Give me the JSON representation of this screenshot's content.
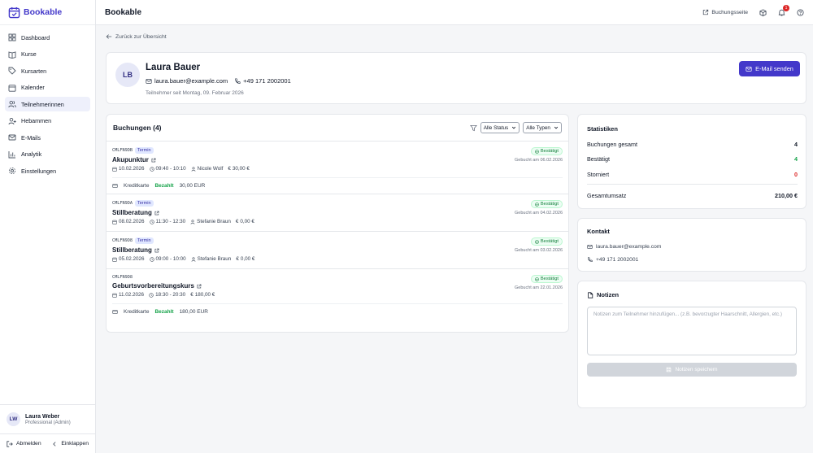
{
  "app": {
    "name": "Bookable"
  },
  "sidebar": {
    "items": [
      {
        "label": "Dashboard",
        "icon": "grid-icon"
      },
      {
        "label": "Kurse",
        "icon": "book-icon"
      },
      {
        "label": "Kursarten",
        "icon": "tag-icon"
      },
      {
        "label": "Kalender",
        "icon": "calendar-icon"
      },
      {
        "label": "Teilnehmerinnen",
        "icon": "users-icon",
        "active": true
      },
      {
        "label": "Hebammen",
        "icon": "user-plus-icon"
      },
      {
        "label": "E-Mails",
        "icon": "mail-icon"
      },
      {
        "label": "Analytik",
        "icon": "bar-chart-icon"
      },
      {
        "label": "Einstellungen",
        "icon": "gear-icon"
      }
    ],
    "user": {
      "initials": "LW",
      "name": "Laura Weber",
      "role": "Professional (Admin)"
    },
    "logout_label": "Abmelden",
    "collapse_label": "Einklappen"
  },
  "header": {
    "title": "Bookable",
    "booking_page_label": "Buchungsseite",
    "notification_count": "1"
  },
  "back_label": "Zurück zur Übersicht",
  "profile": {
    "initials": "LB",
    "name": "Laura Bauer",
    "email": "laura.bauer@example.com",
    "phone": "+49 171 2002001",
    "since": "Teilnehmer seit Montag, 09. Februar 2026",
    "email_button": "E-Mail senden"
  },
  "bookings": {
    "title": "Buchungen (4)",
    "filter_status": "Alle Status",
    "filter_type": "Alle Typen",
    "items": [
      {
        "code": "CMLFN9DB",
        "tag": "Termin",
        "title": "Akupunktur",
        "date": "10.02.2026",
        "time": "09:40 - 10:10",
        "person": "Nicole Wolf",
        "price": "30,00 €",
        "status": "Bestätigt",
        "booked": "Gebucht am 06.02.2026",
        "payment_method": "Kreditkarte",
        "payment_status": "Bezahlt",
        "payment_amount": "30,00 EUR"
      },
      {
        "code": "CMLFN9DA",
        "tag": "Termin",
        "title": "Stillberatung",
        "date": "08.02.2026",
        "time": "11:30 - 12:30",
        "person": "Stefanie Braun",
        "price": "0,00 €",
        "status": "Bestätigt",
        "booked": "Gebucht am 04.02.2026"
      },
      {
        "code": "CMLFN9D8",
        "tag": "Termin",
        "title": "Stillberatung",
        "date": "05.02.2026",
        "time": "09:00 - 10:00",
        "person": "Stefanie Braun",
        "price": "0,00 €",
        "status": "Bestätigt",
        "booked": "Gebucht am 03.02.2026"
      },
      {
        "code": "CMLFN9D8",
        "tag": "",
        "title": "Geburtsvorbereitungskurs",
        "date": "11.02.2026",
        "time": "18:30 - 20:30",
        "person": "",
        "price": "180,00 €",
        "status": "Bestätigt",
        "booked": "Gebucht am 22.01.2026",
        "payment_method": "Kreditkarte",
        "payment_status": "Bezahlt",
        "payment_amount": "180,00 EUR"
      }
    ]
  },
  "stats": {
    "title": "Statistiken",
    "total_label": "Buchungen gesamt",
    "total_value": "4",
    "confirmed_label": "Bestätigt",
    "confirmed_value": "4",
    "cancelled_label": "Storniert",
    "cancelled_value": "0",
    "revenue_label": "Gesamtumsatz",
    "revenue_value": "210,00 €",
    "colors": {
      "confirmed": "#16a34a",
      "cancelled": "#dc2626"
    }
  },
  "contact": {
    "title": "Kontakt",
    "email": "laura.bauer@example.com",
    "phone": "+49 171 2002001"
  },
  "notes": {
    "title": "Notizen",
    "placeholder": "Notizen zum Teilnehmer hinzufügen... (z.B. bevorzugter Haarschnitt, Allergien, etc.)",
    "save_label": "Notizen speichern"
  },
  "colors": {
    "accent": "#4338ca",
    "success": "#16a34a",
    "danger": "#dc2626"
  }
}
